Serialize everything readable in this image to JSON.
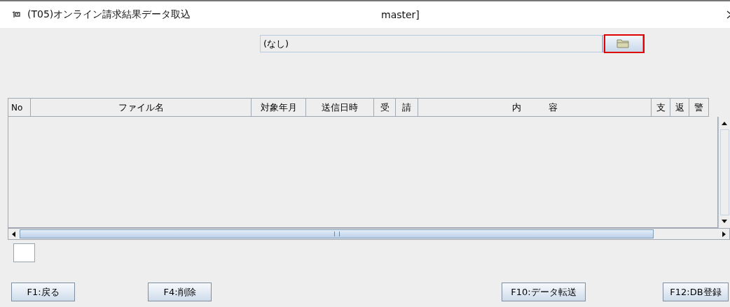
{
  "window": {
    "title": "(T05)オンライン請求結果データ取込",
    "title_suffix": "master]"
  },
  "file_path": {
    "value": "(なし)",
    "browse_highlighted": true
  },
  "table": {
    "columns": [
      {
        "label": "No"
      },
      {
        "label": "ファイル名"
      },
      {
        "label": "対象年月"
      },
      {
        "label": "送信日時"
      },
      {
        "label": "受"
      },
      {
        "label": "請"
      },
      {
        "label": "内　　　容"
      },
      {
        "label": "支"
      },
      {
        "label": "返"
      },
      {
        "label": "警"
      }
    ]
  },
  "buttons": [
    {
      "label": "F1:戻る"
    },
    {
      "label": "F4:削除"
    },
    {
      "label": "F10:データ転送"
    },
    {
      "label": "F12:DB登録"
    }
  ]
}
